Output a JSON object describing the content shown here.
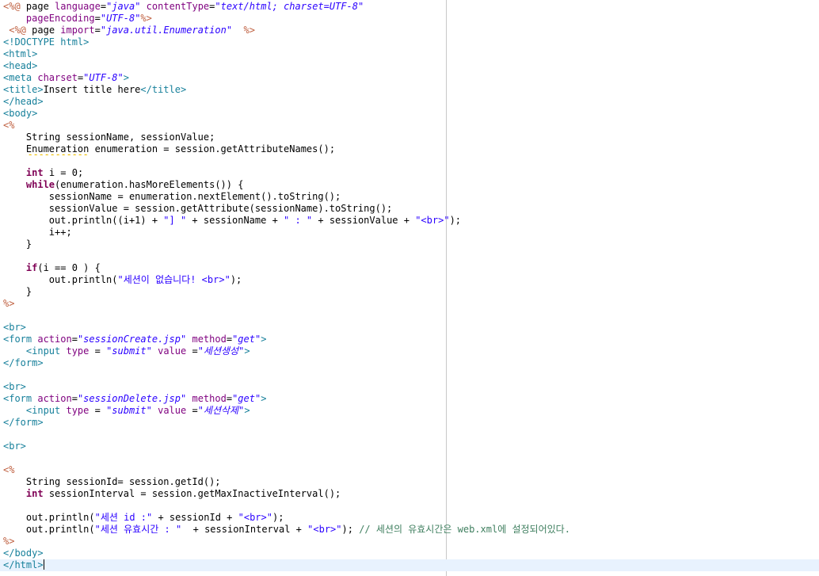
{
  "editor": {
    "file_type": "jsp",
    "theme": {
      "background": "#ffffff",
      "current_line": "#e8f2fe",
      "print_margin": "#c8c8c8",
      "tag": "#17809b",
      "attr": "#7f007f",
      "attr_value": "#2a00ff",
      "jsp_delimiter": "#bf5f3f",
      "keyword": "#7f0055",
      "string": "#2a00ff",
      "comment": "#3f7f5f"
    },
    "current_line_index": 47,
    "lines": [
      [
        [
          "jsp",
          "<%@"
        ],
        [
          "txt",
          " page "
        ],
        [
          "attr",
          "language"
        ],
        [
          "txt",
          "="
        ],
        [
          "aval",
          "\"java\""
        ],
        [
          "txt",
          " "
        ],
        [
          "attr",
          "contentType"
        ],
        [
          "txt",
          "="
        ],
        [
          "aval",
          "\"text/html; charset=UTF-8\""
        ]
      ],
      [
        [
          "txt",
          "    "
        ],
        [
          "attr",
          "pageEncoding"
        ],
        [
          "txt",
          "="
        ],
        [
          "aval",
          "\"UTF-8\""
        ],
        [
          "jsp",
          "%>"
        ]
      ],
      [
        [
          "txt",
          " "
        ],
        [
          "jsp",
          "<%@"
        ],
        [
          "txt",
          " page "
        ],
        [
          "attr",
          "import"
        ],
        [
          "txt",
          "="
        ],
        [
          "aval",
          "\"java.util.Enumeration\""
        ],
        [
          "txt",
          "  "
        ],
        [
          "jsp",
          "%>"
        ]
      ],
      [
        [
          "tag",
          "<!DOCTYPE html>"
        ]
      ],
      [
        [
          "tag",
          "<html>"
        ]
      ],
      [
        [
          "tag",
          "<head>"
        ]
      ],
      [
        [
          "tag",
          "<meta "
        ],
        [
          "attr",
          "charset"
        ],
        [
          "txt",
          "="
        ],
        [
          "aval",
          "\"UTF-8\""
        ],
        [
          "tag",
          ">"
        ]
      ],
      [
        [
          "tag",
          "<title>"
        ],
        [
          "txt",
          "Insert title here"
        ],
        [
          "tag",
          "</title>"
        ]
      ],
      [
        [
          "tag",
          "</head>"
        ]
      ],
      [
        [
          "tag",
          "<body>"
        ]
      ],
      [
        [
          "jsp",
          "<%"
        ]
      ],
      [
        [
          "txt",
          "    String sessionName, sessionValue;"
        ]
      ],
      [
        [
          "txt",
          "    "
        ],
        [
          "err",
          "Enumeration"
        ],
        [
          "txt",
          " enumeration = session.getAttributeNames();"
        ]
      ],
      [
        [
          "txt",
          ""
        ]
      ],
      [
        [
          "txt",
          "    "
        ],
        [
          "kw",
          "int"
        ],
        [
          "txt",
          " i = 0;"
        ]
      ],
      [
        [
          "txt",
          "    "
        ],
        [
          "kw",
          "while"
        ],
        [
          "txt",
          "(enumeration.hasMoreElements()) {"
        ]
      ],
      [
        [
          "txt",
          "        sessionName = enumeration.nextElement().toString();"
        ]
      ],
      [
        [
          "txt",
          "        sessionValue = session.getAttribute(sessionName).toString();"
        ]
      ],
      [
        [
          "txt",
          "        out.println((i+1) + "
        ],
        [
          "str",
          "\"] \""
        ],
        [
          "txt",
          " + sessionName + "
        ],
        [
          "str",
          "\" : \""
        ],
        [
          "txt",
          " + sessionValue + "
        ],
        [
          "str",
          "\"<br>\""
        ],
        [
          "txt",
          ");"
        ]
      ],
      [
        [
          "txt",
          "        i++;"
        ]
      ],
      [
        [
          "txt",
          "    }"
        ]
      ],
      [
        [
          "txt",
          ""
        ]
      ],
      [
        [
          "txt",
          "    "
        ],
        [
          "kw",
          "if"
        ],
        [
          "txt",
          "(i == 0 ) {"
        ]
      ],
      [
        [
          "txt",
          "        out.println("
        ],
        [
          "str",
          "\"세션이 없습니다! <br>\""
        ],
        [
          "txt",
          ");"
        ]
      ],
      [
        [
          "txt",
          "    }"
        ]
      ],
      [
        [
          "jsp",
          "%>"
        ]
      ],
      [
        [
          "txt",
          ""
        ]
      ],
      [
        [
          "tag",
          "<br>"
        ]
      ],
      [
        [
          "tag",
          "<form "
        ],
        [
          "attr",
          "action"
        ],
        [
          "txt",
          "="
        ],
        [
          "aval",
          "\"sessionCreate.jsp\""
        ],
        [
          "txt",
          " "
        ],
        [
          "attr",
          "method"
        ],
        [
          "txt",
          "="
        ],
        [
          "aval",
          "\"get\""
        ],
        [
          "tag",
          ">"
        ]
      ],
      [
        [
          "txt",
          "    "
        ],
        [
          "tag",
          "<input "
        ],
        [
          "attr",
          "type"
        ],
        [
          "txt",
          " = "
        ],
        [
          "aval",
          "\"submit\""
        ],
        [
          "txt",
          " "
        ],
        [
          "attr",
          "value"
        ],
        [
          "txt",
          " ="
        ],
        [
          "aval",
          "\"세션생성\""
        ],
        [
          "tag",
          ">"
        ]
      ],
      [
        [
          "tag",
          "</form>"
        ]
      ],
      [
        [
          "txt",
          ""
        ]
      ],
      [
        [
          "tag",
          "<br>"
        ]
      ],
      [
        [
          "tag",
          "<form "
        ],
        [
          "attr",
          "action"
        ],
        [
          "txt",
          "="
        ],
        [
          "aval",
          "\"sessionDelete.jsp\""
        ],
        [
          "txt",
          " "
        ],
        [
          "attr",
          "method"
        ],
        [
          "txt",
          "="
        ],
        [
          "aval",
          "\"get\""
        ],
        [
          "tag",
          ">"
        ]
      ],
      [
        [
          "txt",
          "    "
        ],
        [
          "tag",
          "<input "
        ],
        [
          "attr",
          "type"
        ],
        [
          "txt",
          " = "
        ],
        [
          "aval",
          "\"submit\""
        ],
        [
          "txt",
          " "
        ],
        [
          "attr",
          "value"
        ],
        [
          "txt",
          " ="
        ],
        [
          "aval",
          "\"세션삭제\""
        ],
        [
          "tag",
          ">"
        ]
      ],
      [
        [
          "tag",
          "</form>"
        ]
      ],
      [
        [
          "txt",
          ""
        ]
      ],
      [
        [
          "tag",
          "<br>"
        ]
      ],
      [
        [
          "txt",
          ""
        ]
      ],
      [
        [
          "jsp",
          "<%"
        ]
      ],
      [
        [
          "txt",
          "    String sessionId= session.getId();"
        ]
      ],
      [
        [
          "txt",
          "    "
        ],
        [
          "kw",
          "int"
        ],
        [
          "txt",
          " sessionInterval = session.getMaxInactiveInterval();"
        ]
      ],
      [
        [
          "txt",
          ""
        ]
      ],
      [
        [
          "txt",
          "    out.println("
        ],
        [
          "str",
          "\"세션 id :\""
        ],
        [
          "txt",
          " + sessionId + "
        ],
        [
          "str",
          "\"<br>\""
        ],
        [
          "txt",
          ");"
        ]
      ],
      [
        [
          "txt",
          "    out.println("
        ],
        [
          "str",
          "\"세션 유효시간 : \""
        ],
        [
          "txt",
          "  + sessionInterval + "
        ],
        [
          "str",
          "\"<br>\""
        ],
        [
          "txt",
          "); "
        ],
        [
          "cmt",
          "// 세션의 유효시간은 web.xml에 설정되어있다."
        ]
      ],
      [
        [
          "jsp",
          "%>"
        ]
      ],
      [
        [
          "tag",
          "</body>"
        ]
      ],
      [
        [
          "tag",
          "</html>"
        ],
        [
          "caret",
          ""
        ]
      ]
    ]
  }
}
